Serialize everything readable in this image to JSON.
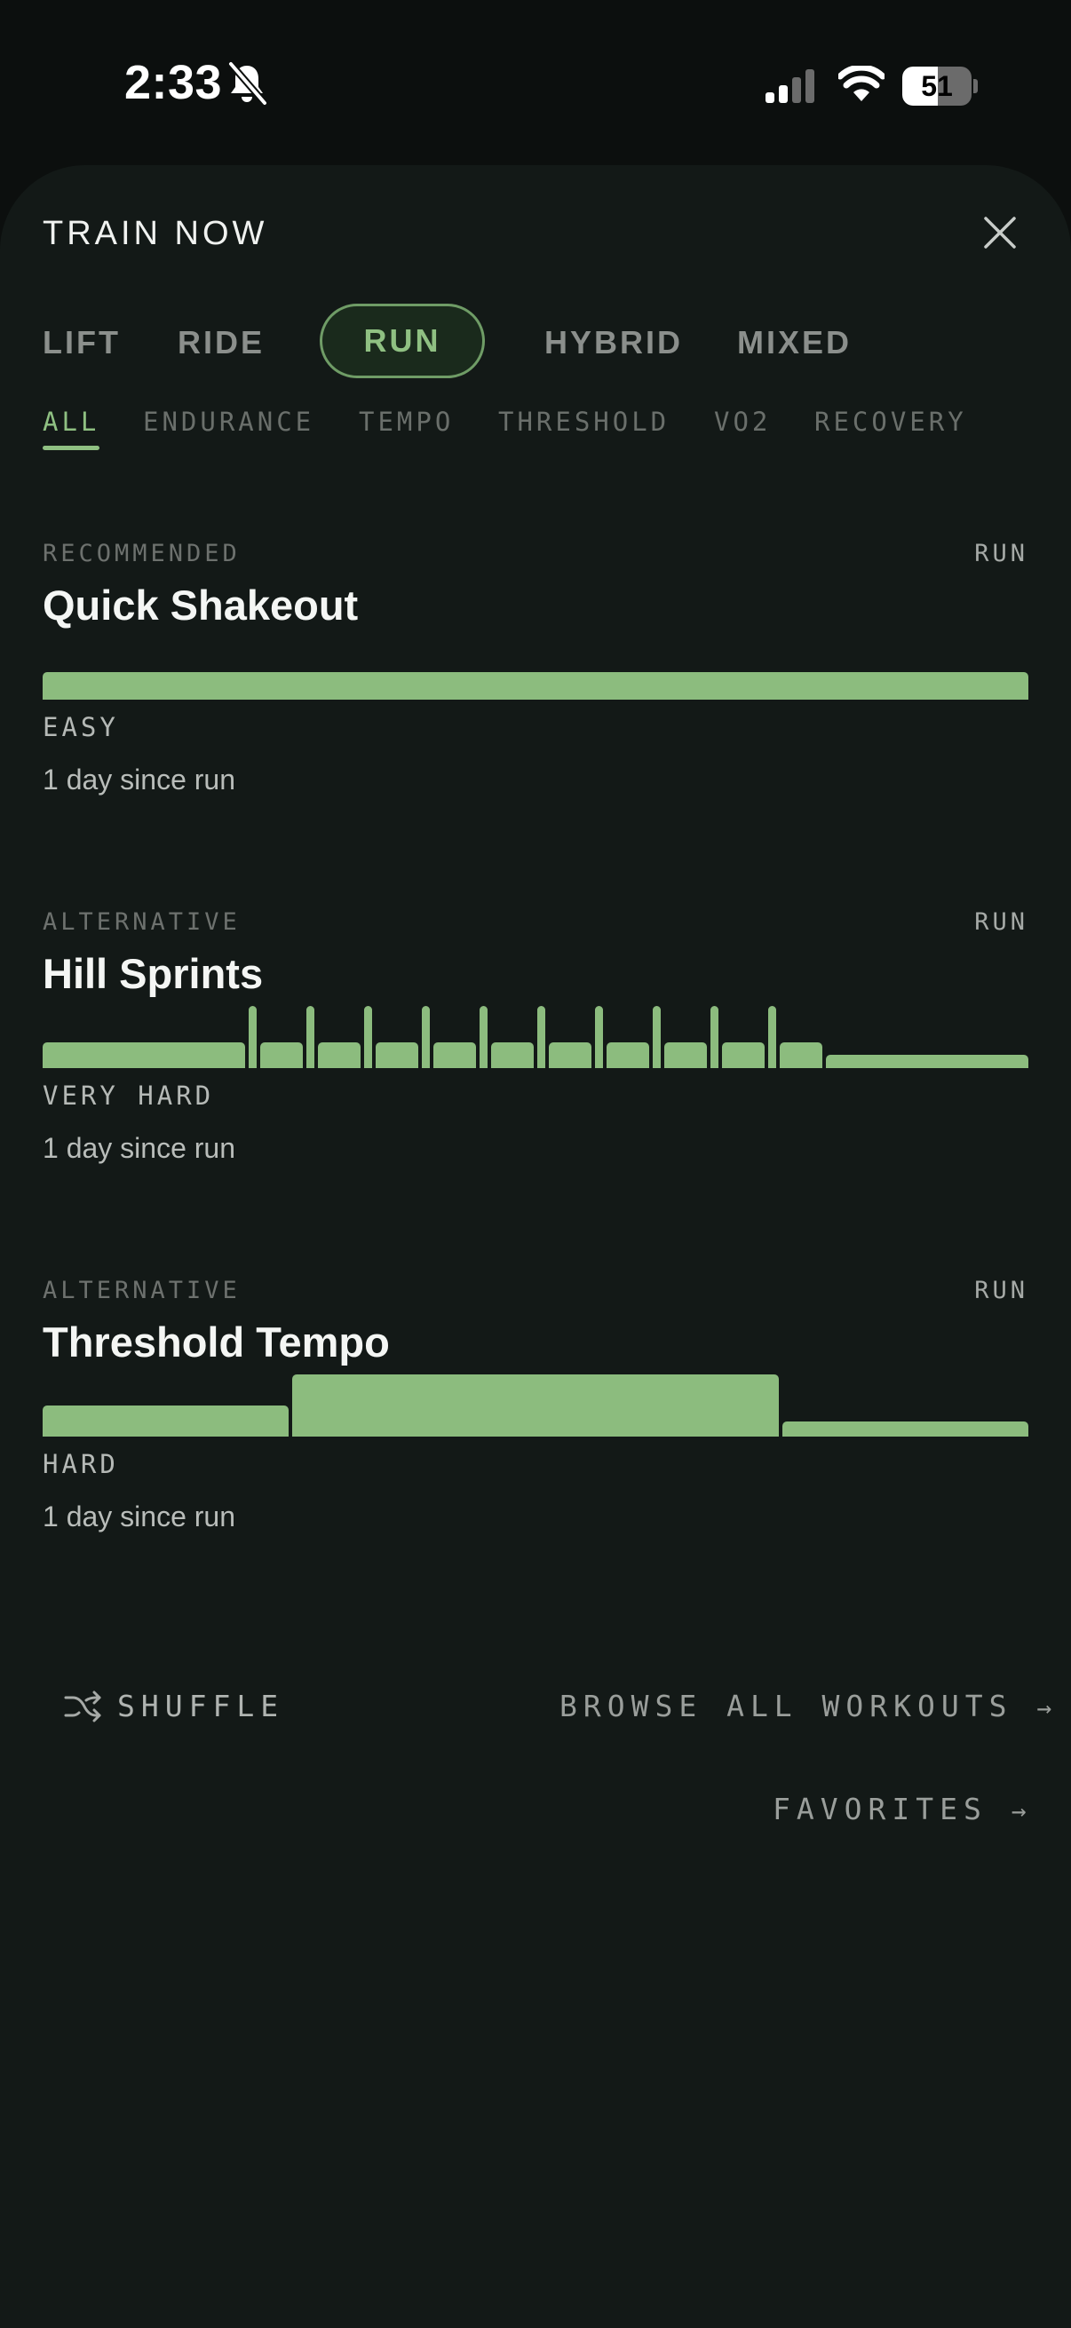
{
  "status": {
    "time": "2:33",
    "battery": "51",
    "battery_level": 0.51
  },
  "sheet": {
    "title": "TRAIN NOW"
  },
  "mode_tabs": [
    {
      "label": "LIFT"
    },
    {
      "label": "RIDE"
    },
    {
      "label": "RUN",
      "active": true
    },
    {
      "label": "HYBRID"
    },
    {
      "label": "MIXED"
    }
  ],
  "sub_tabs": [
    {
      "label": "ALL",
      "active": true
    },
    {
      "label": "ENDURANCE"
    },
    {
      "label": "TEMPO"
    },
    {
      "label": "THRESHOLD"
    },
    {
      "label": "VO2"
    },
    {
      "label": "RECOVERY"
    }
  ],
  "workouts": [
    {
      "tag": "RECOMMENDED",
      "type": "RUN",
      "name": "Quick Shakeout",
      "intensity": "EASY",
      "since": "1 day since run",
      "profile": [
        {
          "w": 1,
          "h": 0.45
        }
      ]
    },
    {
      "tag": "ALTERNATIVE",
      "type": "RUN",
      "name": "Hill Sprints",
      "intensity": "VERY HARD",
      "since": "1 day since run",
      "profile": [
        {
          "w": 0.212,
          "h": 0.42
        },
        {
          "w": 0.008,
          "h": 1
        },
        {
          "w": 0.045,
          "h": 0.42
        },
        {
          "w": 0.008,
          "h": 1
        },
        {
          "w": 0.045,
          "h": 0.42
        },
        {
          "w": 0.008,
          "h": 1
        },
        {
          "w": 0.045,
          "h": 0.42
        },
        {
          "w": 0.008,
          "h": 1
        },
        {
          "w": 0.045,
          "h": 0.42
        },
        {
          "w": 0.008,
          "h": 1
        },
        {
          "w": 0.045,
          "h": 0.42
        },
        {
          "w": 0.008,
          "h": 1
        },
        {
          "w": 0.045,
          "h": 0.42
        },
        {
          "w": 0.008,
          "h": 1
        },
        {
          "w": 0.045,
          "h": 0.42
        },
        {
          "w": 0.008,
          "h": 1
        },
        {
          "w": 0.045,
          "h": 0.42
        },
        {
          "w": 0.008,
          "h": 1
        },
        {
          "w": 0.045,
          "h": 0.42
        },
        {
          "w": 0.008,
          "h": 1
        },
        {
          "w": 0.045,
          "h": 0.42
        },
        {
          "w": 0.212,
          "h": 0.22
        }
      ]
    },
    {
      "tag": "ALTERNATIVE",
      "type": "RUN",
      "name": "Threshold Tempo",
      "intensity": "HARD",
      "since": "1 day since run",
      "profile": [
        {
          "w": 0.25,
          "h": 0.5
        },
        {
          "w": 0.495,
          "h": 1
        },
        {
          "w": 0.25,
          "h": 0.25
        }
      ]
    }
  ],
  "actions": {
    "shuffle": "SHUFFLE",
    "browse": "BROWSE ALL WORKOUTS",
    "favorites": "FAVORITES"
  }
}
